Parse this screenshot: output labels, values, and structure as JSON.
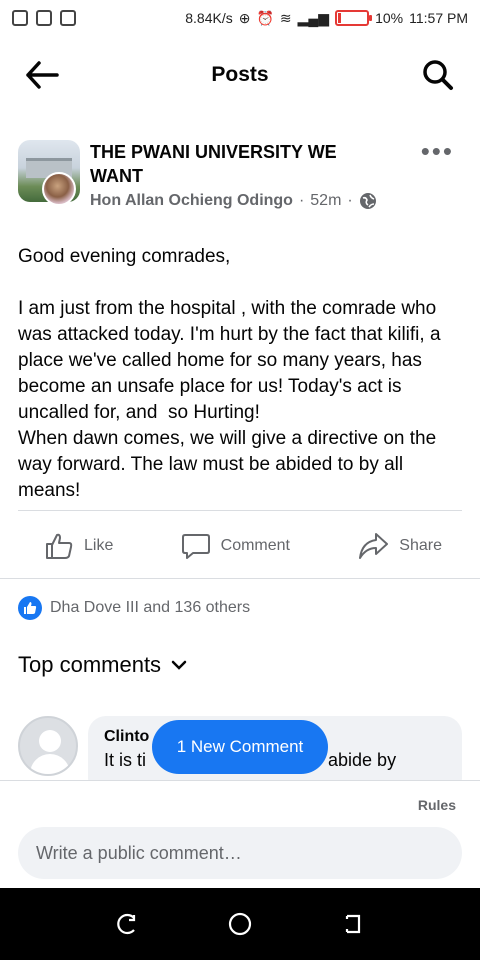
{
  "status_bar": {
    "net_speed": "8.84K/s",
    "battery": "10%",
    "battery_level": 0.1,
    "time": "11:57 PM"
  },
  "header": {
    "title": "Posts",
    "back_icon": "arrow-left-icon",
    "search_icon": "search-icon"
  },
  "post": {
    "group_name": "THE PWANI UNIVERSITY WE WANT",
    "author": "Hon Allan Ochieng Odingo",
    "time": "52m",
    "separator": "·",
    "audience_icon": "globe-icon",
    "more_icon": "more-options-icon",
    "text": "Good evening comrades,\n\nI am just from the hospital , with the comrade who was attacked today. I'm hurt by the fact that kilifi, a place we've called home for so many years, has become an unsafe place for us! Today's act is uncalled for, and  so Hurting!\nWhen dawn comes, we will give a directive on the way forward. The law must be abided to by all means!"
  },
  "actions": {
    "like": "Like",
    "comment": "Comment",
    "share": "Share"
  },
  "reactions": {
    "summary": "Dha Dove III and 136 others"
  },
  "comments": {
    "section_title": "Top comments",
    "new_comment_pill": "1 New Comment",
    "first": {
      "name": "Clinto",
      "text": "It is ti",
      "text_tail": "abide by"
    }
  },
  "composer": {
    "rules": "Rules",
    "placeholder": "Write a public comment…"
  },
  "colors": {
    "brand_blue": "#1877f2",
    "secondary_text": "#65676b",
    "bubble_bg": "#f0f2f5",
    "battery_red": "#e53935"
  }
}
